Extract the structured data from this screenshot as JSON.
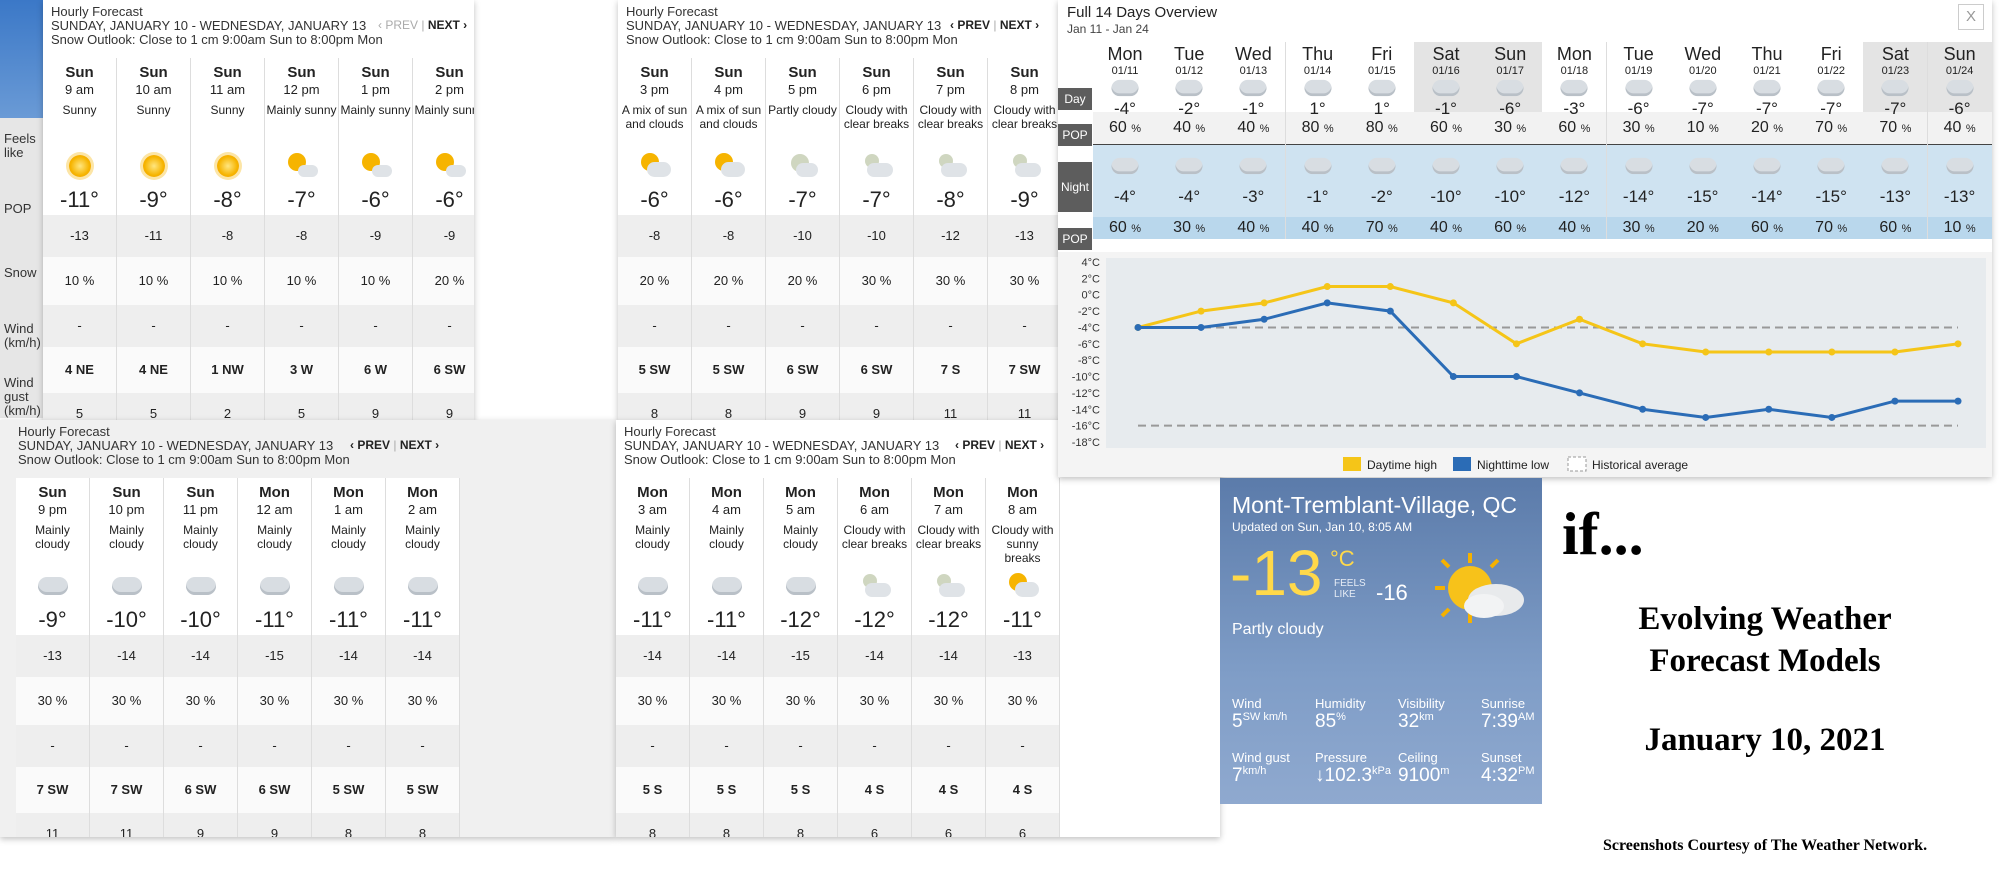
{
  "panels": [
    {
      "id": "p1",
      "title": "Hourly Forecast",
      "dates": "SUNDAY, JANUARY 10 - WEDNESDAY, JANUARY 13",
      "outlook": "Snow Outlook: Close to 1 cm 9:00am Sun to 8:00pm Mon",
      "prev": "‹ PREV",
      "sep": "|",
      "next": "NEXT ›",
      "hours": [
        {
          "day": "Sun",
          "time": "9 am",
          "cond": "Sunny",
          "icon": "sun-icon",
          "temp": "-11°",
          "feels": "-13",
          "pop": "10 %",
          "snow": "-",
          "wind": "4 NE",
          "gust": "5"
        },
        {
          "day": "Sun",
          "time": "10 am",
          "cond": "Sunny",
          "icon": "sun-icon",
          "temp": "-9°",
          "feels": "-11",
          "pop": "10 %",
          "snow": "-",
          "wind": "4 NE",
          "gust": "5"
        },
        {
          "day": "Sun",
          "time": "11 am",
          "cond": "Sunny",
          "icon": "sun-icon",
          "temp": "-8°",
          "feels": "-8",
          "pop": "10 %",
          "snow": "-",
          "wind": "1 NW",
          "gust": "2"
        },
        {
          "day": "Sun",
          "time": "12 pm",
          "cond": "Mainly sunny",
          "icon": "mainly-sunny-icon",
          "temp": "-7°",
          "feels": "-8",
          "pop": "10 %",
          "snow": "-",
          "wind": "3 W",
          "gust": "5"
        },
        {
          "day": "Sun",
          "time": "1 pm",
          "cond": "Mainly sunny",
          "icon": "mainly-sunny-icon",
          "temp": "-6°",
          "feels": "-9",
          "pop": "10 %",
          "snow": "-",
          "wind": "6 W",
          "gust": "9"
        },
        {
          "day": "Sun",
          "time": "2 pm",
          "cond": "Mainly sunny",
          "icon": "mainly-sunny-icon",
          "temp": "-6°",
          "feels": "-9",
          "pop": "20 %",
          "snow": "-",
          "wind": "6 SW",
          "gust": "9"
        }
      ]
    },
    {
      "id": "p2",
      "title": "Hourly Forecast",
      "dates": "SUNDAY, JANUARY 10 - WEDNESDAY, JANUARY 13",
      "outlook": "Snow Outlook: Close to 1 cm 9:00am Sun to 8:00pm Mon",
      "prev": "‹ PREV",
      "sep": "|",
      "next": "NEXT ›",
      "hours": [
        {
          "day": "Sun",
          "time": "3 pm",
          "cond": "A mix of sun and clouds",
          "icon": "mixed-icon",
          "temp": "-6°",
          "feels": "-8",
          "pop": "20 %",
          "snow": "-",
          "wind": "5 SW",
          "gust": "8"
        },
        {
          "day": "Sun",
          "time": "4 pm",
          "cond": "A mix of sun and clouds",
          "icon": "mixed-icon",
          "temp": "-6°",
          "feels": "-8",
          "pop": "20 %",
          "snow": "-",
          "wind": "5 SW",
          "gust": "8"
        },
        {
          "day": "Sun",
          "time": "5 pm",
          "cond": "Partly cloudy",
          "icon": "partly-cloudy-night-icon",
          "temp": "-7°",
          "feels": "-10",
          "pop": "20 %",
          "snow": "-",
          "wind": "6 SW",
          "gust": "9"
        },
        {
          "day": "Sun",
          "time": "6 pm",
          "cond": "Cloudy with clear breaks",
          "icon": "cloudy-breaks-night-icon",
          "temp": "-7°",
          "feels": "-10",
          "pop": "30 %",
          "snow": "-",
          "wind": "6 SW",
          "gust": "9"
        },
        {
          "day": "Sun",
          "time": "7 pm",
          "cond": "Cloudy with clear breaks",
          "icon": "cloudy-breaks-night-icon",
          "temp": "-8°",
          "feels": "-12",
          "pop": "30 %",
          "snow": "-",
          "wind": "7 S",
          "gust": "11"
        },
        {
          "day": "Sun",
          "time": "8 pm",
          "cond": "Cloudy with clear breaks",
          "icon": "cloudy-breaks-night-icon",
          "temp": "-9°",
          "feels": "-13",
          "pop": "30 %",
          "snow": "-",
          "wind": "7 SW",
          "gust": "11"
        }
      ]
    },
    {
      "id": "p3",
      "title": "Hourly Forecast",
      "dates": "SUNDAY, JANUARY 10 - WEDNESDAY, JANUARY 13",
      "outlook": "Snow Outlook: Close to 1 cm 9:00am Sun to 8:00pm Mon",
      "prev": "‹ PREV",
      "sep": "|",
      "next": "NEXT ›",
      "hours": [
        {
          "day": "Sun",
          "time": "9 pm",
          "cond": "Mainly cloudy",
          "icon": "cloud-icon",
          "temp": "-9°",
          "feels": "-13",
          "pop": "30 %",
          "snow": "-",
          "wind": "7 SW",
          "gust": "11"
        },
        {
          "day": "Sun",
          "time": "10 pm",
          "cond": "Mainly cloudy",
          "icon": "cloud-icon",
          "temp": "-10°",
          "feels": "-14",
          "pop": "30 %",
          "snow": "-",
          "wind": "7 SW",
          "gust": "11"
        },
        {
          "day": "Sun",
          "time": "11 pm",
          "cond": "Mainly cloudy",
          "icon": "cloud-icon",
          "temp": "-10°",
          "feels": "-14",
          "pop": "30 %",
          "snow": "-",
          "wind": "6 SW",
          "gust": "9"
        },
        {
          "day": "Mon",
          "time": "12 am",
          "cond": "Mainly cloudy",
          "icon": "cloud-icon",
          "temp": "-11°",
          "feels": "-15",
          "pop": "30 %",
          "snow": "-",
          "wind": "6 SW",
          "gust": "9"
        },
        {
          "day": "Mon",
          "time": "1 am",
          "cond": "Mainly cloudy",
          "icon": "cloud-icon",
          "temp": "-11°",
          "feels": "-14",
          "pop": "30 %",
          "snow": "-",
          "wind": "5 SW",
          "gust": "8"
        },
        {
          "day": "Mon",
          "time": "2 am",
          "cond": "Mainly cloudy",
          "icon": "cloud-icon",
          "temp": "-11°",
          "feels": "-14",
          "pop": "30 %",
          "snow": "-",
          "wind": "5 SW",
          "gust": "8"
        }
      ]
    },
    {
      "id": "p4",
      "title": "Hourly Forecast",
      "dates": "SUNDAY, JANUARY 10 - WEDNESDAY, JANUARY 13",
      "outlook": "Snow Outlook: Close to 1 cm 9:00am Sun to 8:00pm Mon",
      "prev": "‹ PREV",
      "sep": "|",
      "next": "NEXT ›",
      "hours": [
        {
          "day": "Mon",
          "time": "3 am",
          "cond": "Mainly cloudy",
          "icon": "cloud-icon",
          "temp": "-11°",
          "feels": "-14",
          "pop": "30 %",
          "snow": "-",
          "wind": "5 S",
          "gust": "8"
        },
        {
          "day": "Mon",
          "time": "4 am",
          "cond": "Mainly cloudy",
          "icon": "cloud-icon",
          "temp": "-11°",
          "feels": "-14",
          "pop": "30 %",
          "snow": "-",
          "wind": "5 S",
          "gust": "8"
        },
        {
          "day": "Mon",
          "time": "5 am",
          "cond": "Mainly cloudy",
          "icon": "cloud-icon",
          "temp": "-12°",
          "feels": "-15",
          "pop": "30 %",
          "snow": "-",
          "wind": "5 S",
          "gust": "8"
        },
        {
          "day": "Mon",
          "time": "6 am",
          "cond": "Cloudy with clear breaks",
          "icon": "cloudy-breaks-night-icon",
          "temp": "-12°",
          "feels": "-14",
          "pop": "30 %",
          "snow": "-",
          "wind": "4 S",
          "gust": "6"
        },
        {
          "day": "Mon",
          "time": "7 am",
          "cond": "Cloudy with clear breaks",
          "icon": "cloudy-breaks-night-icon",
          "temp": "-12°",
          "feels": "-14",
          "pop": "30 %",
          "snow": "-",
          "wind": "4 S",
          "gust": "6"
        },
        {
          "day": "Mon",
          "time": "8 am",
          "cond": "Cloudy with sunny breaks",
          "icon": "mixed-icon",
          "temp": "-11°",
          "feels": "-13",
          "pop": "30 %",
          "snow": "-",
          "wind": "4 S",
          "gust": "6"
        }
      ]
    }
  ],
  "side_labels": {
    "feels": "Feels like",
    "pop": "POP",
    "snow": "Snow",
    "wind": "Wind (km/h)",
    "gust": "Wind gust (km/h)"
  },
  "fourteen": {
    "title": "Full 14 Days Overview",
    "range": "Jan 11 - Jan 24",
    "close": "X",
    "row_labels": {
      "day": "Day",
      "pop": "POP",
      "night": "Night",
      "pop2": "POP"
    },
    "days": [
      {
        "dow": "Mon",
        "date": "01/11",
        "day_temp": "-4°",
        "day_pop": "60",
        "night_temp": "-4°",
        "night_pop": "60"
      },
      {
        "dow": "Tue",
        "date": "01/12",
        "day_temp": "-2°",
        "day_pop": "40",
        "night_temp": "-4°",
        "night_pop": "30"
      },
      {
        "dow": "Wed",
        "date": "01/13",
        "day_temp": "-1°",
        "day_pop": "40",
        "night_temp": "-3°",
        "night_pop": "40"
      },
      {
        "dow": "Thu",
        "date": "01/14",
        "day_temp": "1°",
        "day_pop": "80",
        "night_temp": "-1°",
        "night_pop": "40"
      },
      {
        "dow": "Fri",
        "date": "01/15",
        "day_temp": "1°",
        "day_pop": "80",
        "night_temp": "-2°",
        "night_pop": "70"
      },
      {
        "dow": "Sat",
        "date": "01/16",
        "day_temp": "-1°",
        "day_pop": "60",
        "night_temp": "-10°",
        "night_pop": "40"
      },
      {
        "dow": "Sun",
        "date": "01/17",
        "day_temp": "-6°",
        "day_pop": "30",
        "night_temp": "-10°",
        "night_pop": "60"
      },
      {
        "dow": "Mon",
        "date": "01/18",
        "day_temp": "-3°",
        "day_pop": "60",
        "night_temp": "-12°",
        "night_pop": "40"
      },
      {
        "dow": "Tue",
        "date": "01/19",
        "day_temp": "-6°",
        "day_pop": "30",
        "night_temp": "-14°",
        "night_pop": "30"
      },
      {
        "dow": "Wed",
        "date": "01/20",
        "day_temp": "-7°",
        "day_pop": "10",
        "night_temp": "-15°",
        "night_pop": "20"
      },
      {
        "dow": "Thu",
        "date": "01/21",
        "day_temp": "-7°",
        "day_pop": "20",
        "night_temp": "-14°",
        "night_pop": "60"
      },
      {
        "dow": "Fri",
        "date": "01/22",
        "day_temp": "-7°",
        "day_pop": "70",
        "night_temp": "-15°",
        "night_pop": "70"
      },
      {
        "dow": "Sat",
        "date": "01/23",
        "day_temp": "-7°",
        "day_pop": "70",
        "night_temp": "-13°",
        "night_pop": "60"
      },
      {
        "dow": "Sun",
        "date": "01/24",
        "day_temp": "-6°",
        "day_pop": "40",
        "night_temp": "-13°",
        "night_pop": "10"
      }
    ],
    "pct": "%"
  },
  "chart_data": {
    "type": "line",
    "x": [
      "01/11",
      "01/12",
      "01/13",
      "01/14",
      "01/15",
      "01/16",
      "01/17",
      "01/18",
      "01/19",
      "01/20",
      "01/21",
      "01/22",
      "01/23",
      "01/24"
    ],
    "series": [
      {
        "name": "Daytime high",
        "color": "#f5c518",
        "values": [
          -4,
          -2,
          -1,
          1,
          1,
          -1,
          -6,
          -3,
          -6,
          -7,
          -7,
          -7,
          -7,
          -6
        ]
      },
      {
        "name": "Nighttime low",
        "color": "#2b6cb6",
        "values": [
          -4,
          -4,
          -3,
          -1,
          -2,
          -10,
          -10,
          -12,
          -14,
          -15,
          -14,
          -15,
          -13,
          -13
        ]
      }
    ],
    "historical": {
      "name": "Historical average",
      "high": -4,
      "low": -16
    },
    "yticks": [
      "4°C",
      "2°C",
      "0°C",
      "-2°C",
      "-4°C",
      "-6°C",
      "-8°C",
      "-10°C",
      "-12°C",
      "-14°C",
      "-16°C",
      "-18°C"
    ],
    "ylim": [
      -18,
      4
    ],
    "grid": false,
    "legend": "bottom"
  },
  "current": {
    "location": "Mont-Tremblant-Village, QC",
    "updated": "Updated on Sun, Jan 10, 8:05 AM",
    "temp": "-13",
    "unit": "°C",
    "feels_label_1": "FEELS",
    "feels_label_2": "LIKE",
    "feels": "-16",
    "condition": "Partly cloudy",
    "stats": [
      {
        "label": "Wind",
        "value": "5",
        "unit": "SW km/h"
      },
      {
        "label": "Humidity",
        "value": "85",
        "unit": "%"
      },
      {
        "label": "Visibility",
        "value": "32",
        "unit": "km"
      },
      {
        "label": "Sunrise",
        "value": "7:39",
        "unit": "AM"
      },
      {
        "label": "Wind gust",
        "value": "7",
        "unit": "km/h"
      },
      {
        "label": "Pressure",
        "value": "↓102.3",
        "unit": "kPa"
      },
      {
        "label": "Ceiling",
        "value": "9100",
        "unit": "m"
      },
      {
        "label": "Sunset",
        "value": "4:32",
        "unit": "PM"
      }
    ]
  },
  "caption": {
    "if": "if...",
    "line1": "Evolving Weather",
    "line2": "Forecast Models",
    "date": "January 10, 2021",
    "credit": "Screenshots Courtesy of The Weather Network."
  }
}
